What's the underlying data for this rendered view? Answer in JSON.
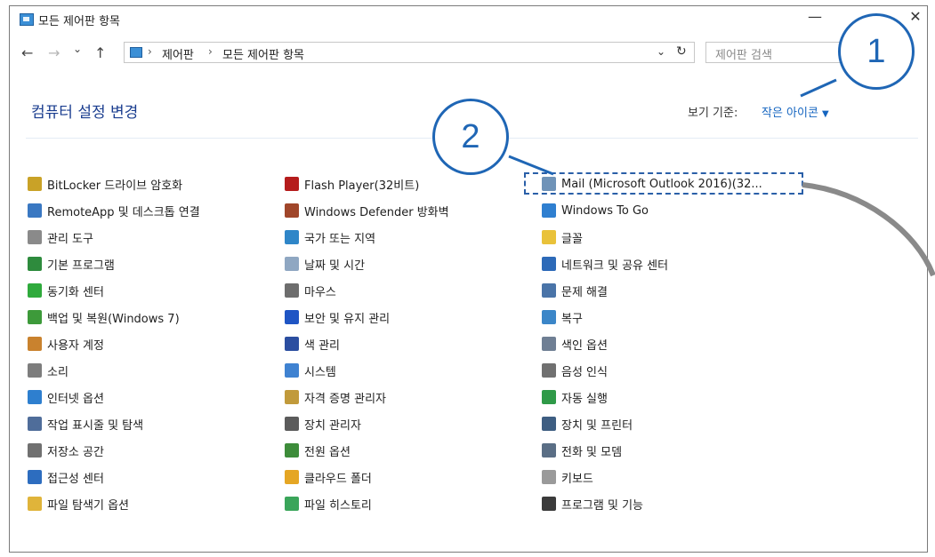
{
  "window": {
    "title": "모든 제어판 항목",
    "minimize": "—",
    "close": "✕"
  },
  "nav": {
    "back": "←",
    "forward": "→",
    "recent": "⌄",
    "up": "↑",
    "breadcrumb": [
      "제어판",
      "모든 제어판 항목"
    ],
    "separator": "›",
    "dropdown": "⌄",
    "refresh": "↻",
    "search_placeholder": "제어판 검색"
  },
  "header": {
    "title": "컴퓨터 설정 변경",
    "view_by_label": "보기 기준:",
    "view_by_value": "작은 아이콘",
    "view_caret": "▼"
  },
  "columns": [
    [
      {
        "label": "BitLocker 드라이브 암호화",
        "icon": "bitlocker-icon",
        "color": "#c9a227"
      },
      {
        "label": "RemoteApp 및 데스크톱 연결",
        "icon": "remoteapp-icon",
        "color": "#3a78c2"
      },
      {
        "label": "관리 도구",
        "icon": "admin-tools-icon",
        "color": "#8a8a8a"
      },
      {
        "label": "기본 프로그램",
        "icon": "default-programs-icon",
        "color": "#2e8b3d"
      },
      {
        "label": "동기화 센터",
        "icon": "sync-center-icon",
        "color": "#2faa3c"
      },
      {
        "label": "백업 및 복원(Windows 7)",
        "icon": "backup-icon",
        "color": "#3d9a3a"
      },
      {
        "label": "사용자 계정",
        "icon": "user-accounts-icon",
        "color": "#c9822e"
      },
      {
        "label": "소리",
        "icon": "sound-icon",
        "color": "#7d7d7d"
      },
      {
        "label": "인터넷 옵션",
        "icon": "internet-options-icon",
        "color": "#2e7fcf"
      },
      {
        "label": "작업 표시줄 및 탐색",
        "icon": "taskbar-icon",
        "color": "#4f6d9a"
      },
      {
        "label": "저장소 공간",
        "icon": "storage-spaces-icon",
        "color": "#707070"
      },
      {
        "label": "접근성 센터",
        "icon": "ease-of-access-icon",
        "color": "#2d6dbf"
      },
      {
        "label": "파일 탐색기 옵션",
        "icon": "file-explorer-options-icon",
        "color": "#e0b43a"
      }
    ],
    [
      {
        "label": "Flash Player(32비트)",
        "icon": "flash-player-icon",
        "color": "#b51c1c"
      },
      {
        "label": "Windows Defender 방화벽",
        "icon": "firewall-icon",
        "color": "#a0462a"
      },
      {
        "label": "국가 또는 지역",
        "icon": "region-icon",
        "color": "#2f86c8"
      },
      {
        "label": "날짜 및 시간",
        "icon": "date-time-icon",
        "color": "#8fa7c2"
      },
      {
        "label": "마우스",
        "icon": "mouse-icon",
        "color": "#6d6d6d"
      },
      {
        "label": "보안 및 유지 관리",
        "icon": "security-flag-icon",
        "color": "#1f55c4"
      },
      {
        "label": "색 관리",
        "icon": "color-management-icon",
        "color": "#2b4ea0"
      },
      {
        "label": "시스템",
        "icon": "system-icon",
        "color": "#3f82d1"
      },
      {
        "label": "자격 증명 관리자",
        "icon": "credential-manager-icon",
        "color": "#c19a3b"
      },
      {
        "label": "장치 관리자",
        "icon": "device-manager-icon",
        "color": "#5b5b5b"
      },
      {
        "label": "전원 옵션",
        "icon": "power-options-icon",
        "color": "#3d8c3a"
      },
      {
        "label": "클라우드 폴더",
        "icon": "cloud-folder-icon",
        "color": "#e5a624"
      },
      {
        "label": "파일 히스토리",
        "icon": "file-history-icon",
        "color": "#3aa55a"
      }
    ],
    [
      {
        "label": "Mail (Microsoft Outlook 2016)(32...",
        "icon": "mail-icon",
        "color": "#6f93b8"
      },
      {
        "label": "Windows To Go",
        "icon": "windows-to-go-icon",
        "color": "#2f7fd0"
      },
      {
        "label": "글꼴",
        "icon": "fonts-icon",
        "color": "#e9c23a"
      },
      {
        "label": "네트워크 및 공유 센터",
        "icon": "network-center-icon",
        "color": "#2d6ab8"
      },
      {
        "label": "문제 해결",
        "icon": "troubleshooting-icon",
        "color": "#4a74a8"
      },
      {
        "label": "복구",
        "icon": "recovery-icon",
        "color": "#3b86c8"
      },
      {
        "label": "색인 옵션",
        "icon": "indexing-options-icon",
        "color": "#6f7f94"
      },
      {
        "label": "음성 인식",
        "icon": "speech-recognition-icon",
        "color": "#707070"
      },
      {
        "label": "자동 실행",
        "icon": "autoplay-icon",
        "color": "#2f9a48"
      },
      {
        "label": "장치 및 프린터",
        "icon": "devices-printers-icon",
        "color": "#3e5e82"
      },
      {
        "label": "전화 및 모뎀",
        "icon": "phone-modem-icon",
        "color": "#5a6e85"
      },
      {
        "label": "키보드",
        "icon": "keyboard-icon",
        "color": "#9a9a9a"
      },
      {
        "label": "프로그램 및 기능",
        "icon": "programs-features-icon",
        "color": "#3b3b3b"
      }
    ]
  ],
  "callouts": [
    "1",
    "2"
  ],
  "accent": "#1f66b5"
}
